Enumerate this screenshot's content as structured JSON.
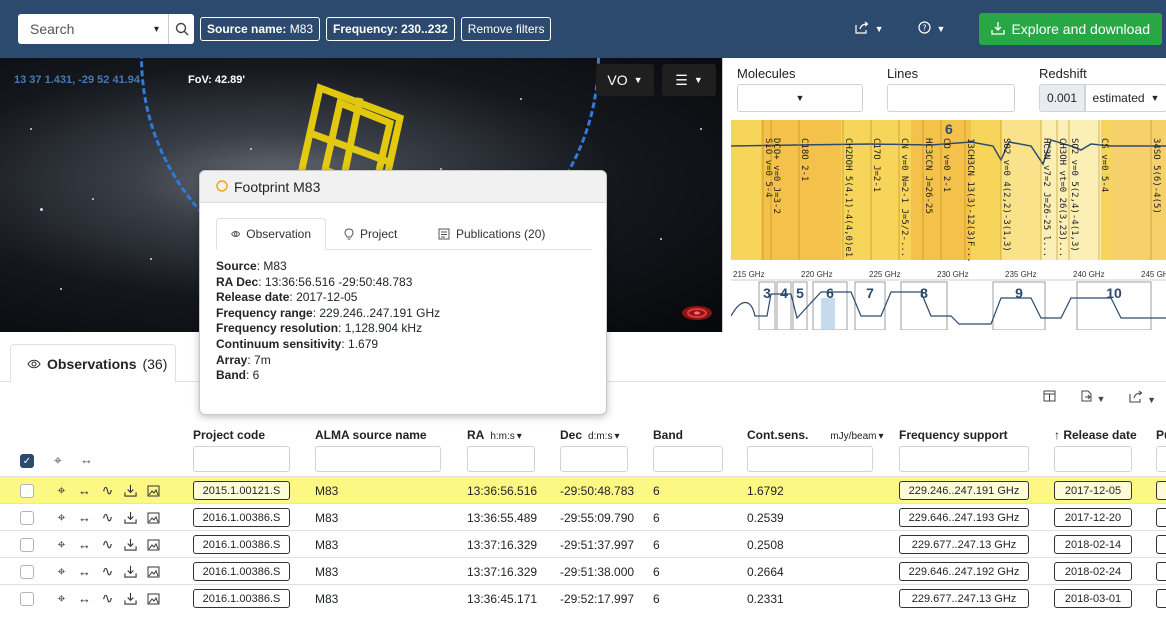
{
  "search": {
    "placeholder": "Search"
  },
  "filters": [
    {
      "key": "Source name:",
      "value": "M83"
    },
    {
      "key": "Frequency:",
      "value": "230..232"
    }
  ],
  "remove_filters_label": "Remove filters",
  "explore_label": "Explore and download",
  "sky": {
    "coords": "13 37 1.431, -29 52 41.94",
    "fov": "FoV: 42.89'",
    "vo_label": "VO"
  },
  "spectral": {
    "molecules_label": "Molecules",
    "lines_label": "Lines",
    "redshift_label": "Redshift",
    "redshift_value": "0.001",
    "redshift_mode": "estimated",
    "current_band": "6",
    "line_labels": [
      "SiO v=0 5-4",
      "DCO+ v=0 J=3-2",
      "C18O 2-1",
      "CH2DOH 5(4,1)-4(4,0)e1",
      "C17O J=2-1",
      "CN v=0 N=2-1 J=5/2-...",
      "HC3CCN J=26-25",
      "CO v=0 2-1",
      "13CH3CN 13(3)-12(3)F...",
      "SO2 v=0 4(2,2)-3(1,3)",
      "HC3N v7=2 J=26-25 l...",
      "CH3OH vt=0 26(3,23)...",
      "SO2 v=0 5(2,4)-4(1,3)",
      "CS v=0 5-4",
      "34SO 5(6)-4(5)"
    ],
    "freq_ticks": [
      "215 GHz",
      "220 GHz",
      "225 GHz",
      "230 GHz",
      "235 GHz",
      "240 GHz",
      "245 GHz"
    ],
    "band_labels": [
      "3",
      "4",
      "5",
      "6",
      "7",
      "8",
      "9",
      "10"
    ]
  },
  "popup": {
    "title": "Footprint M83",
    "tabs": [
      "Observation",
      "Project",
      "Publications (20)"
    ],
    "fields": [
      {
        "label": "Source",
        "value": "M83"
      },
      {
        "label": "RA Dec",
        "value": "13:36:56.516 -29:50:48.783"
      },
      {
        "label": "Release date",
        "value": "2017-12-05"
      },
      {
        "label": "Frequency range",
        "value": "229.246..247.191 GHz"
      },
      {
        "label": "Frequency resolution",
        "value": "1,128.904 kHz"
      },
      {
        "label": "Continuum sensitivity",
        "value": "1.679"
      },
      {
        "label": "Array",
        "value": "7m"
      },
      {
        "label": "Band",
        "value": "6"
      }
    ]
  },
  "obs_tab": {
    "label": "Observations",
    "count": "(36)"
  },
  "columns": {
    "project": "Project code",
    "source": "ALMA source name",
    "ra": "RA",
    "ra_unit": "h:m:s",
    "dec": "Dec",
    "dec_unit": "d:m:s",
    "band": "Band",
    "cont": "Cont.sens.",
    "cont_unit": "mJy/beam",
    "freq": "Frequency support",
    "release": "Release date",
    "pi": "Pu"
  },
  "rows": [
    {
      "project": "2015.1.00121.S",
      "source": "M83",
      "ra": "13:36:56.516",
      "dec": "-29:50:48.783",
      "band": "6",
      "cont": "1.6792",
      "freq": "229.246..247.191 GHz",
      "release": "2017-12-05"
    },
    {
      "project": "2016.1.00386.S",
      "source": "M83",
      "ra": "13:36:55.489",
      "dec": "-29:55:09.790",
      "band": "6",
      "cont": "0.2539",
      "freq": "229.646..247.193 GHz",
      "release": "2017-12-20"
    },
    {
      "project": "2016.1.00386.S",
      "source": "M83",
      "ra": "13:37:16.329",
      "dec": "-29:51:37.997",
      "band": "6",
      "cont": "0.2508",
      "freq": "229.677..247.13 GHz",
      "release": "2018-02-14"
    },
    {
      "project": "2016.1.00386.S",
      "source": "M83",
      "ra": "13:37:16.329",
      "dec": "-29:51:38.000",
      "band": "6",
      "cont": "0.2664",
      "freq": "229.646..247.192 GHz",
      "release": "2018-02-24"
    },
    {
      "project": "2016.1.00386.S",
      "source": "M83",
      "ra": "13:36:45.171",
      "dec": "-29:52:17.997",
      "band": "6",
      "cont": "0.2331",
      "freq": "229.677..247.13 GHz",
      "release": "2018-03-01"
    }
  ],
  "colors": {
    "topbar": "#2c4a6e",
    "accent_green": "#28a745",
    "selected_row": "#fdf784",
    "footprint": "#f5d90a"
  }
}
